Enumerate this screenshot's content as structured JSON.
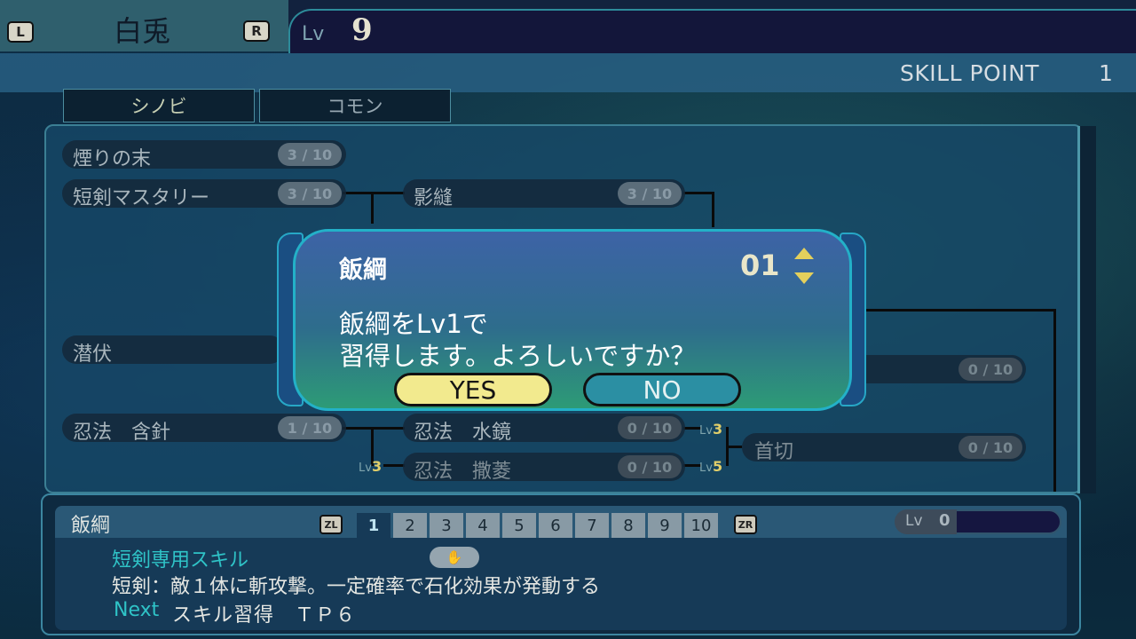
{
  "header": {
    "left_shoulder": "L",
    "right_shoulder": "R",
    "character_name": "白兎",
    "level_label": "Lv",
    "level_value": "9"
  },
  "skill_point": {
    "label": "SKILL POINT",
    "value": "1"
  },
  "tabs": [
    {
      "label": "シノビ",
      "active": true
    },
    {
      "label": "コモン",
      "active": false
    }
  ],
  "skill_tree": {
    "nodes": [
      {
        "name": "煙りの末",
        "level": "3",
        "max": "10"
      },
      {
        "name": "短剣マスタリー",
        "level": "3",
        "max": "10"
      },
      {
        "name": "影縫",
        "level": "3",
        "max": "10"
      },
      {
        "name": "潜伏",
        "level": "",
        "max": ""
      },
      {
        "name": "忍法　含針",
        "level": "1",
        "max": "10"
      },
      {
        "name": "忍法　水鏡",
        "level": "0",
        "max": "10"
      },
      {
        "name": "忍法　撒菱",
        "level": "0",
        "max": "10"
      },
      {
        "name": "首切",
        "level": "0",
        "max": "10"
      },
      {
        "name": "",
        "level": "0",
        "max": "10"
      }
    ],
    "requirements": [
      {
        "prefix": "Lv",
        "value": "3"
      },
      {
        "prefix": "Lv",
        "value": "3"
      },
      {
        "prefix": "Lv",
        "value": "5"
      },
      {
        "prefix": "Lv",
        "value": "5"
      }
    ]
  },
  "dialog": {
    "skill_name": "飯綱",
    "count": "01",
    "message_line1": "飯綱をLv1で",
    "message_line2": "習得します。よろしいですか？",
    "yes_label": "YES",
    "no_label": "NO"
  },
  "info": {
    "skill_name": "飯綱",
    "zl_label": "ZL",
    "zr_label": "ZR",
    "level_tabs": [
      "1",
      "2",
      "3",
      "4",
      "5",
      "6",
      "7",
      "8",
      "9",
      "10"
    ],
    "level_label": "Lv",
    "level_value": "0",
    "category": "短剣専用スキル",
    "hand_icon_glyph": "✋",
    "description": "短剣：敵１体に斬攻撃。一定確率で石化効果が発動する",
    "next_label": "Next",
    "next_text": "スキル習得　ＴＰ６"
  },
  "colors": {
    "accent_teal": "#2fc3c7",
    "yes_button": "#f2ea8e",
    "no_button": "#2b8fa3",
    "dialog_border": "#23b1c8"
  }
}
